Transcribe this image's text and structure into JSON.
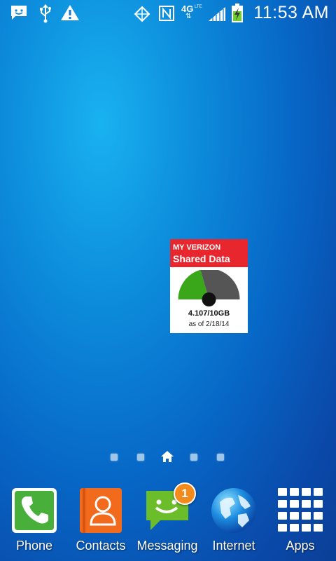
{
  "status_bar": {
    "time": "11:53 AM",
    "network_type": "4G",
    "network_sub": "LTE",
    "icons": [
      "message-notification-icon",
      "usb-icon",
      "warning-icon",
      "gps-icon",
      "nfc-icon",
      "signal-icon",
      "battery-charging-icon"
    ]
  },
  "widget": {
    "brand": "MY VERIZON",
    "title": "Shared Data",
    "usage": "4.107/10GB",
    "as_of": "as of 2/18/14",
    "used_fraction": 0.41,
    "colors": {
      "header": "#e8262e",
      "used": "#3aa71b",
      "remaining": "#555555"
    }
  },
  "pages": {
    "count": 5,
    "current": 3
  },
  "dock": {
    "items": [
      {
        "label": "Phone",
        "icon": "phone-icon"
      },
      {
        "label": "Contacts",
        "icon": "contacts-icon"
      },
      {
        "label": "Messaging",
        "icon": "messaging-icon",
        "badge": "1"
      },
      {
        "label": "Internet",
        "icon": "globe-icon"
      },
      {
        "label": "Apps",
        "icon": "apps-grid-icon"
      }
    ]
  }
}
